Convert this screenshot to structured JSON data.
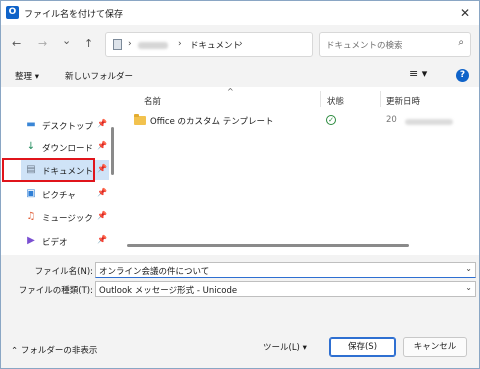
{
  "window": {
    "title": "ファイル名を付けて保存",
    "app_icon": "O",
    "close_glyph": "✕"
  },
  "nav_buttons": {
    "back": "←",
    "forward": "→",
    "recent": "⌄",
    "up": "↑"
  },
  "address": {
    "separator": "›",
    "current": "ドキュメント",
    "dropdown": "⌄",
    "refresh": "↻"
  },
  "search": {
    "placeholder": "ドキュメントの検索",
    "icon": "⌕"
  },
  "toolbar": {
    "organize": "整理 ▾",
    "new_folder": "新しいフォルダー",
    "view": "≡ ▾",
    "help": "?"
  },
  "sidebar": {
    "pin_glyph": "📌",
    "items": [
      {
        "label": "デスクトップ",
        "icon": "desktop-icon",
        "glyph": "▬",
        "color": "#3a86d6"
      },
      {
        "label": "ダウンロード",
        "icon": "download-icon",
        "glyph": "↓",
        "color": "#1f8a5b"
      },
      {
        "label": "ドキュメント",
        "icon": "document-icon",
        "glyph": "▤",
        "color": "#6c7a89",
        "selected": true
      },
      {
        "label": "ピクチャ",
        "icon": "pictures-icon",
        "glyph": "▣",
        "color": "#2f7fd6"
      },
      {
        "label": "ミュージック",
        "icon": "music-icon",
        "glyph": "♫",
        "color": "#e0603a"
      },
      {
        "label": "ビデオ",
        "icon": "video-icon",
        "glyph": "▶",
        "color": "#7a4fd1"
      }
    ]
  },
  "file_list": {
    "sort_caret": "^",
    "columns": {
      "name": "名前",
      "status": "状態",
      "date": "更新日時"
    },
    "rows": [
      {
        "name": "Office のカスタム テンプレート",
        "status_glyph": "✓",
        "date_prefix": "20"
      }
    ]
  },
  "form": {
    "filename_label": "ファイル名(N):",
    "filename_value": "オンライン会議の件について",
    "type_label": "ファイルの種類(T):",
    "type_value": "Outlook メッセージ形式 - Unicode",
    "dropdown": "⌄"
  },
  "footer": {
    "hide_folders": "⌃  フォルダーの非表示",
    "tools": "ツール(L)    ▾",
    "save": "保存(S)",
    "cancel": "キャンセル"
  }
}
